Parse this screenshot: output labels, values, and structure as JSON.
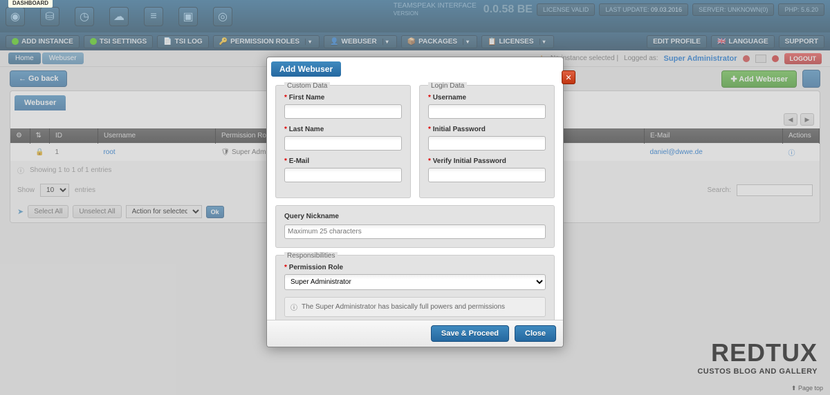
{
  "header": {
    "label": "TEAMSPEAK INTERFACE",
    "version_lbl": "VERSION",
    "version": "0.0.58 BE",
    "license": "LICENSE VALID",
    "last_update_lbl": "LAST UPDATE:",
    "last_update_val": "09.03.2016",
    "server_lbl": "SERVER:",
    "server_val": "UNKNOWN(0)",
    "php_lbl": "PHP:",
    "php_val": "5.6.20",
    "dashboard": "DASHBOARD"
  },
  "menu": {
    "add_instance": "ADD INSTANCE",
    "tsi_settings": "TSI SETTINGS",
    "tsi_log": "TSI LOG",
    "permission_roles": "PERMISSION ROLES",
    "webuser": "WEBUSER",
    "packages": "PACKAGES",
    "licenses": "LICENSES",
    "edit_profile": "EDIT PROFILE",
    "language": "LANGUAGE",
    "support": "SUPPORT"
  },
  "breadcrumb": {
    "home": "Home",
    "current": "Webuser"
  },
  "info": {
    "no_instance": "No instance selected |",
    "logged_as": "Logged as:",
    "user": "Super Administrator",
    "logout": "LOGOUT"
  },
  "actions": {
    "go_back": "← Go back",
    "add_webuser": "✚ Add Webuser"
  },
  "panel": {
    "title": "Webuser"
  },
  "columns": {
    "id": "ID",
    "username": "Username",
    "permission_role": "Permission Role",
    "email": "E-Mail",
    "actions": "Actions"
  },
  "row": {
    "id": "1",
    "username": "root",
    "role": "Super Administrator",
    "email": "daniel@dwwe.de"
  },
  "footer": {
    "showing": "Showing 1 to 1 of 1 entries",
    "show": "Show",
    "entries": "entries",
    "search": "Search:",
    "select_all": "Select All",
    "unselect_all": "Unselect All",
    "action_for": "Action for selected...",
    "ok": "Ok",
    "count": "10"
  },
  "modal": {
    "title": "Add Webuser",
    "custom_data": "Custom Data",
    "login_data": "Login Data",
    "first_name": "First Name",
    "last_name": "Last Name",
    "email": "E-Mail",
    "username": "Username",
    "initial_pw": "Initial Password",
    "verify_pw": "Verify Initial Password",
    "query_nick": "Query Nickname",
    "query_ph": "Maximum 25 characters",
    "responsibilities": "Responsibilities",
    "perm_role": "Permission Role",
    "perm_sel": "Super Administrator",
    "info": "The Super Administrator has basically full powers and permissions",
    "save": "Save & Proceed",
    "close": "Close"
  },
  "logo": {
    "main": "REDTUX",
    "sub": "CUSTOS BLOG AND GALLERY"
  },
  "pagetop": "⬆ Page top"
}
